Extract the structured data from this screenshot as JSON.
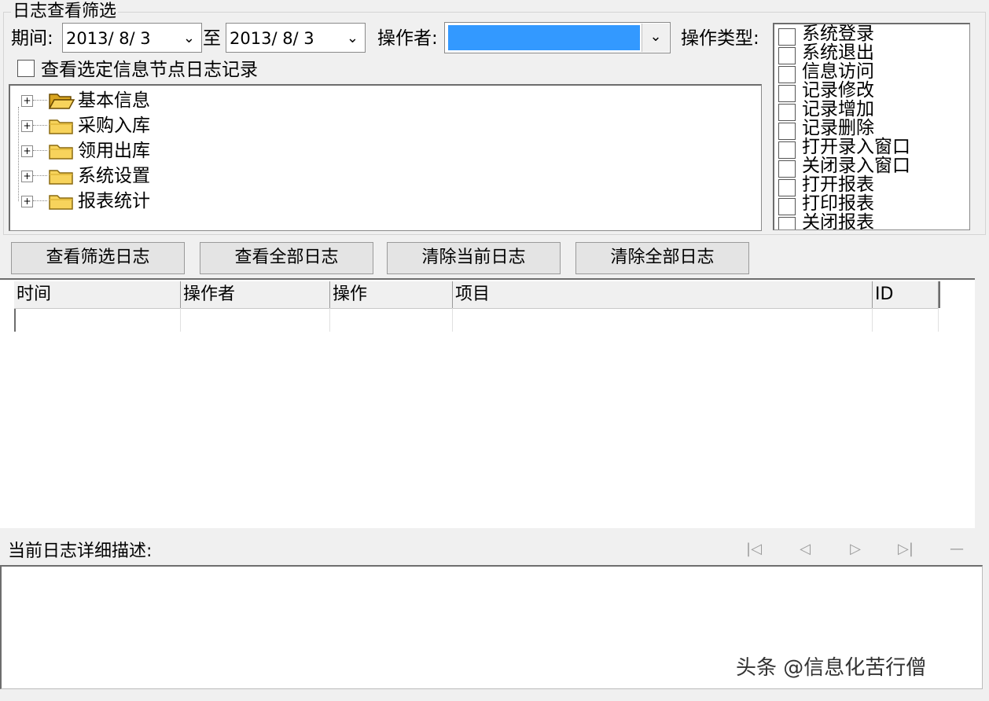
{
  "filter": {
    "group_title": "日志查看筛选",
    "period_label": "期间:",
    "date_from": "2013/ 8/ 3",
    "to_label": "至",
    "date_to": "2013/ 8/ 3",
    "operator_label": "操作者:",
    "op_type_label": "操作类型:",
    "node_checkbox_label": "查看选定信息节点日志记录"
  },
  "tree": {
    "items": [
      {
        "label": "基本信息",
        "icon": "open-folder-icon"
      },
      {
        "label": "采购入库",
        "icon": "folder-icon"
      },
      {
        "label": "领用出库",
        "icon": "folder-icon"
      },
      {
        "label": "系统设置",
        "icon": "folder-icon"
      },
      {
        "label": "报表统计",
        "icon": "folder-icon"
      }
    ]
  },
  "op_types": [
    "系统登录",
    "系统退出",
    "信息访问",
    "记录修改",
    "记录增加",
    "记录删除",
    "打开录入窗口",
    "关闭录入窗口",
    "打开报表",
    "打印报表",
    "关闭报表"
  ],
  "buttons": {
    "view_filtered": "查看筛选日志",
    "view_all": "查看全部日志",
    "clear_current": "清除当前日志",
    "clear_all": "清除全部日志"
  },
  "grid": {
    "columns": [
      "时间",
      "操作者",
      "操作",
      "项目",
      "ID"
    ]
  },
  "detail": {
    "label": "当前日志详细描述:"
  },
  "watermark": "头条 @信息化苦行僧",
  "colors": {
    "selection": "#3399ff",
    "folder": "#f7d35c",
    "background": "#f0f0f0"
  }
}
